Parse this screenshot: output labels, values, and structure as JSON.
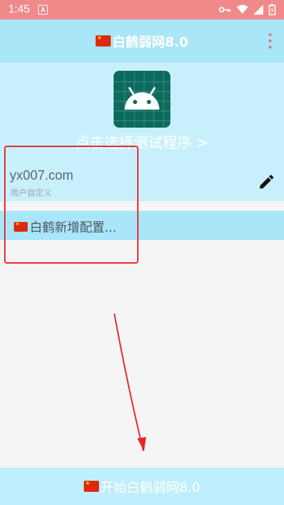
{
  "status_bar": {
    "time": "1:45",
    "notification_letter": "A",
    "battery_symbol": "⚡"
  },
  "app_bar": {
    "title": "白鹤弱网8.0"
  },
  "header": {
    "select_program_label": "点击选择测试程序 >"
  },
  "configs": [
    {
      "host": "yx007.com",
      "type": "用户自定义"
    },
    {
      "label": "白鹤新增配置..."
    }
  ],
  "bottom": {
    "start_label": "开始白鹤弱网8.0"
  },
  "colors": {
    "status_bar": "#f08a8a",
    "app_bar": "#a8e6f8",
    "header": "#c8f0fc",
    "app_icon": "#0c6b5e",
    "annotation": "#e8262a"
  }
}
